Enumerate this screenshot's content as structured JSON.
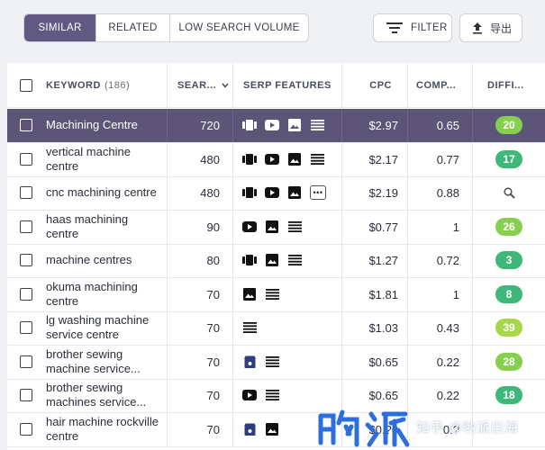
{
  "tabs": [
    {
      "label": "SIMILAR",
      "active": true
    },
    {
      "label": "RELATED",
      "active": false
    },
    {
      "label": "LOW SEARCH VOLUME",
      "active": false
    }
  ],
  "filter_label": "FILTER",
  "export_label": "导出",
  "columns": {
    "keyword": "KEYWORD",
    "keyword_count": "(186)",
    "volume": "SEAR...",
    "serp": "SERP FEATURES",
    "cpc": "CPC",
    "competition": "COMP...",
    "difficulty": "DIFFI..."
  },
  "rows": [
    {
      "keyword": "Machining Centre",
      "volume": "720",
      "serp": [
        "cards-icon",
        "youtube-icon",
        "image-icon",
        "list-icon"
      ],
      "cpc": "$2.97",
      "comp": "0.65",
      "difficulty": "20",
      "color": "#86cf4f",
      "selected": true
    },
    {
      "keyword": "vertical machine centre",
      "volume": "480",
      "serp": [
        "cards-icon",
        "youtube-icon",
        "image-icon",
        "list-icon"
      ],
      "cpc": "$2.17",
      "comp": "0.77",
      "difficulty": "17",
      "color": "#3fb77a"
    },
    {
      "keyword": "cnc machining centre",
      "volume": "480",
      "serp": [
        "cards-icon",
        "youtube-icon",
        "image-icon",
        "more-icon"
      ],
      "cpc": "$2.19",
      "comp": "0.88",
      "difficulty": "",
      "color": ""
    },
    {
      "keyword": "haas machining centre",
      "volume": "90",
      "serp": [
        "youtube-icon",
        "image-icon",
        "list-icon"
      ],
      "cpc": "$0.77",
      "comp": "1",
      "difficulty": "26",
      "color": "#86cf4f"
    },
    {
      "keyword": "machine centres",
      "volume": "80",
      "serp": [
        "cards-icon",
        "image-icon",
        "list-icon"
      ],
      "cpc": "$1.27",
      "comp": "0.72",
      "difficulty": "3",
      "color": "#3fb77a"
    },
    {
      "keyword": "okuma machining centre",
      "volume": "70",
      "serp": [
        "image-icon",
        "list-icon"
      ],
      "cpc": "$1.81",
      "comp": "1",
      "difficulty": "8",
      "color": "#3fb77a"
    },
    {
      "keyword": "lg washing machine service centre",
      "volume": "70",
      "serp": [
        "list-icon"
      ],
      "cpc": "$1.03",
      "comp": "0.43",
      "difficulty": "39",
      "color": "#a8d74a"
    },
    {
      "keyword": "brother sewing machine service...",
      "volume": "70",
      "serp": [
        "local-icon",
        "list-icon"
      ],
      "cpc": "$0.65",
      "comp": "0.22",
      "difficulty": "28",
      "color": "#86cf4f"
    },
    {
      "keyword": "brother sewing machines service...",
      "volume": "70",
      "serp": [
        "youtube-icon",
        "list-icon"
      ],
      "cpc": "$0.65",
      "comp": "0.22",
      "difficulty": "18",
      "color": "#3fb77a"
    },
    {
      "keyword": "hair machine rockville centre",
      "volume": "70",
      "serp": [
        "local-icon",
        "image-icon"
      ],
      "cpc": "$0.?0",
      "comp": "0.?",
      "difficulty": "",
      "color": ""
    }
  ],
  "watermark": "知乎 @哟派出海"
}
